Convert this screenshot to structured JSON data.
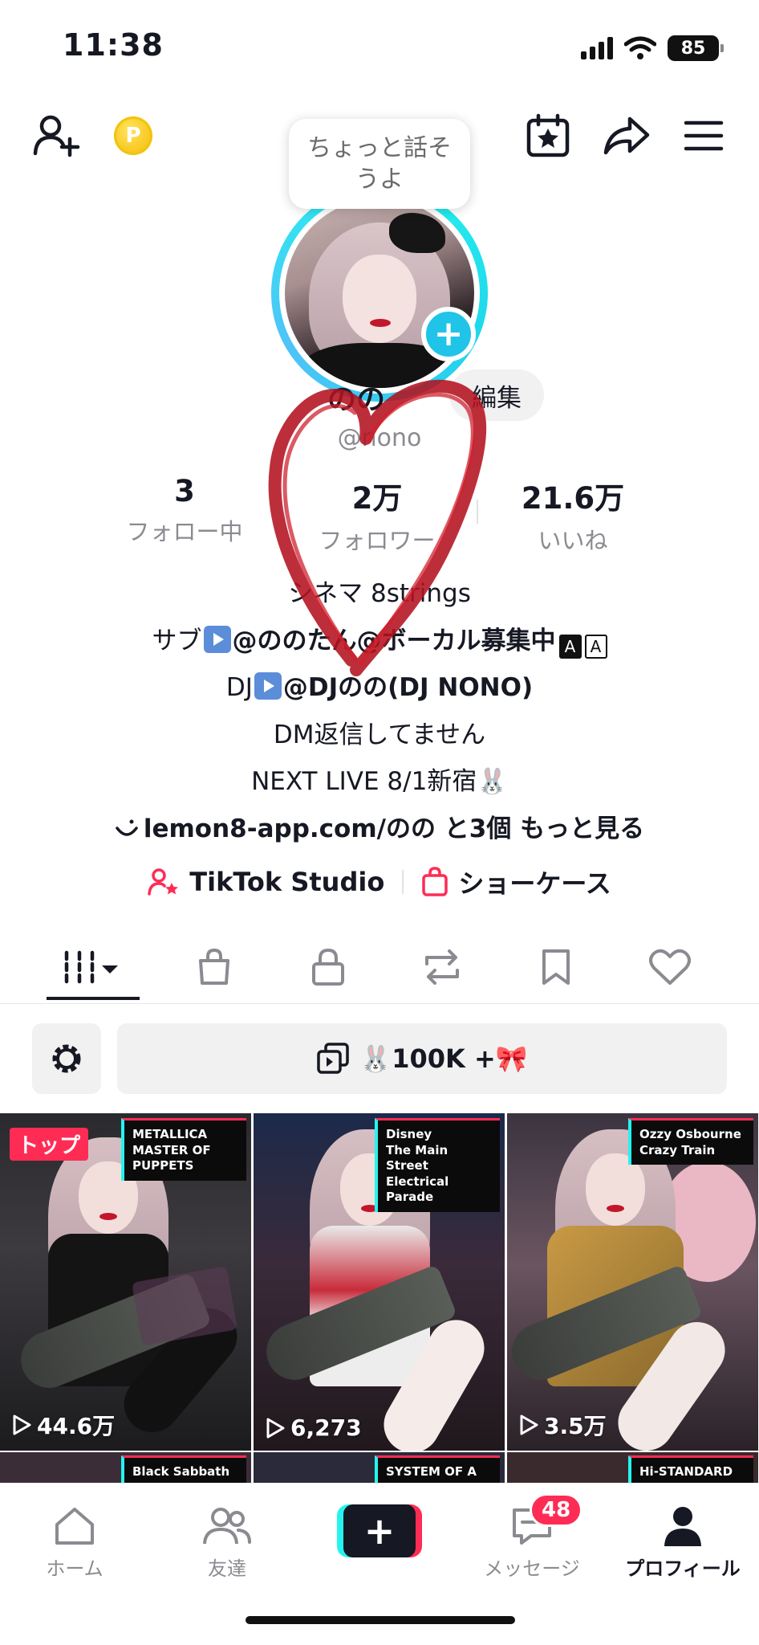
{
  "status_bar": {
    "time": "11:38",
    "battery": "85"
  },
  "bubble": {
    "text": "ちょっと話そうよ"
  },
  "profile": {
    "nickname": "のの",
    "edit_label": "編集",
    "username": "@nono"
  },
  "stats": [
    {
      "value": "3",
      "label": "フォロー中"
    },
    {
      "value": "2万",
      "label": "フォロワー"
    },
    {
      "value": "21.6万",
      "label": "いいね"
    }
  ],
  "bio": {
    "line1": "シネマ 8strings",
    "line2_prefix": "サブ",
    "line2_text": "@ののたん@ボーカル募集中",
    "line2_badge1": "A",
    "line2_badge2": "A",
    "line3_prefix": "DJ",
    "line3_text": "@DJのの(DJ NONO)",
    "line4": "DM返信してません",
    "line5": "NEXT LIVE 8/1新宿🐰",
    "link_text": "lemon8-app.com/のの",
    "link_more": "と3個 もっと見る"
  },
  "shortcuts": {
    "studio_label": "TikTok Studio",
    "showcase_label": "ショーケース"
  },
  "collection": {
    "label": "🐰100K +🎀"
  },
  "videos": [
    {
      "badge": "トップ",
      "tag_lines": [
        "METALLICA",
        "MASTER OF PUPPETS"
      ],
      "views": "44.6万"
    },
    {
      "badge": "",
      "tag_lines": [
        "Disney",
        "The Main Street",
        "Electrical Parade"
      ],
      "views": "6,273"
    },
    {
      "badge": "",
      "tag_lines": [
        "Ozzy Osbourne",
        "Crazy Train"
      ],
      "views": "3.5万"
    }
  ],
  "videos_row2": [
    {
      "tag": "Black Sabbath"
    },
    {
      "tag": "SYSTEM OF A DOWN"
    },
    {
      "tag": "Hi-STANDARD"
    }
  ],
  "bottom_nav": {
    "home": "ホーム",
    "friends": "友達",
    "messages": "メッセージ",
    "messages_badge": "48",
    "profile": "プロフィール"
  },
  "colors": {
    "accent_red": "#fe2c55",
    "accent_cyan": "#25f4ee",
    "text": "#161823",
    "muted": "#8a8b91"
  }
}
